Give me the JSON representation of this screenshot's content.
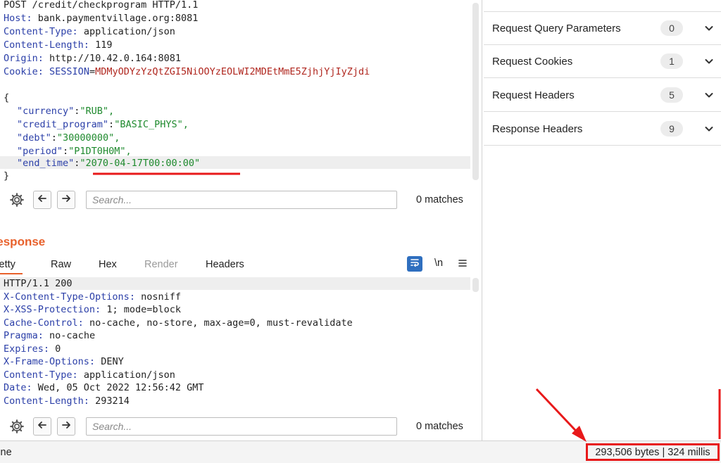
{
  "request": {
    "start_line": "POST /credit/checkprogram HTTP/1.1",
    "headers": [
      {
        "name": "Host",
        "value": "bank.paymentvillage.org:8081"
      },
      {
        "name": "Content-Type",
        "value": "application/json"
      },
      {
        "name": "Content-Length",
        "value": "119"
      },
      {
        "name": "Origin",
        "value": "http://10.42.0.164:8081"
      }
    ],
    "cookie": {
      "name": "Cookie",
      "key": "SESSION",
      "value": "MDMyODYzYzQtZGI5NiOOYzEOLWI2MDEtMmE5ZjhjYjIyZjdi"
    },
    "body_open": "{",
    "body_close": "}",
    "body": [
      {
        "key": "\"currency\"",
        "value": "\"RUB\","
      },
      {
        "key": "\"credit_program\"",
        "value": "\"BASIC_PHYS\","
      },
      {
        "key": "\"debt\"",
        "value": "\"30000000\","
      },
      {
        "key": "\"period\"",
        "value": "\"P1DT0H0M\","
      },
      {
        "key": "\"end_time\"",
        "value": "\"2070-04-17T00:00:00\""
      }
    ]
  },
  "search": {
    "placeholder": "Search...",
    "matches": "0 matches"
  },
  "response": {
    "title": "Response",
    "tabs": [
      "Pretty",
      "Raw",
      "Hex",
      "Render",
      "Headers"
    ],
    "newline_toggle": "\\n",
    "status_line": "HTTP/1.1 200",
    "headers": [
      {
        "name": "X-Content-Type-Options",
        "value": "nosniff"
      },
      {
        "name": "X-XSS-Protection",
        "value": "1; mode=block"
      },
      {
        "name": "Cache-Control",
        "value": "no-cache, no-store, max-age=0, must-revalidate"
      },
      {
        "name": "Pragma",
        "value": "no-cache"
      },
      {
        "name": "Expires",
        "value": "0"
      },
      {
        "name": "X-Frame-Options",
        "value": "DENY"
      },
      {
        "name": "Content-Type",
        "value": "application/json"
      },
      {
        "name": "Date",
        "value": "Wed, 05 Oct 2022 12:56:42 GMT"
      },
      {
        "name": "Content-Length",
        "value": "293214"
      }
    ]
  },
  "inspector": {
    "rows": [
      {
        "label": "Request Query Parameters",
        "count": "0"
      },
      {
        "label": "Request Cookies",
        "count": "1"
      },
      {
        "label": "Request Headers",
        "count": "5"
      },
      {
        "label": "Response Headers",
        "count": "9"
      }
    ]
  },
  "status_bar": {
    "left": "Done",
    "right": "293,506 bytes | 324 millis"
  },
  "colors": {
    "accent": "#e8612c",
    "annotation": "#e8191a",
    "header_name": "#2b3fa8",
    "json_string": "#1f8a2e",
    "cookie_value": "#b0271f"
  }
}
